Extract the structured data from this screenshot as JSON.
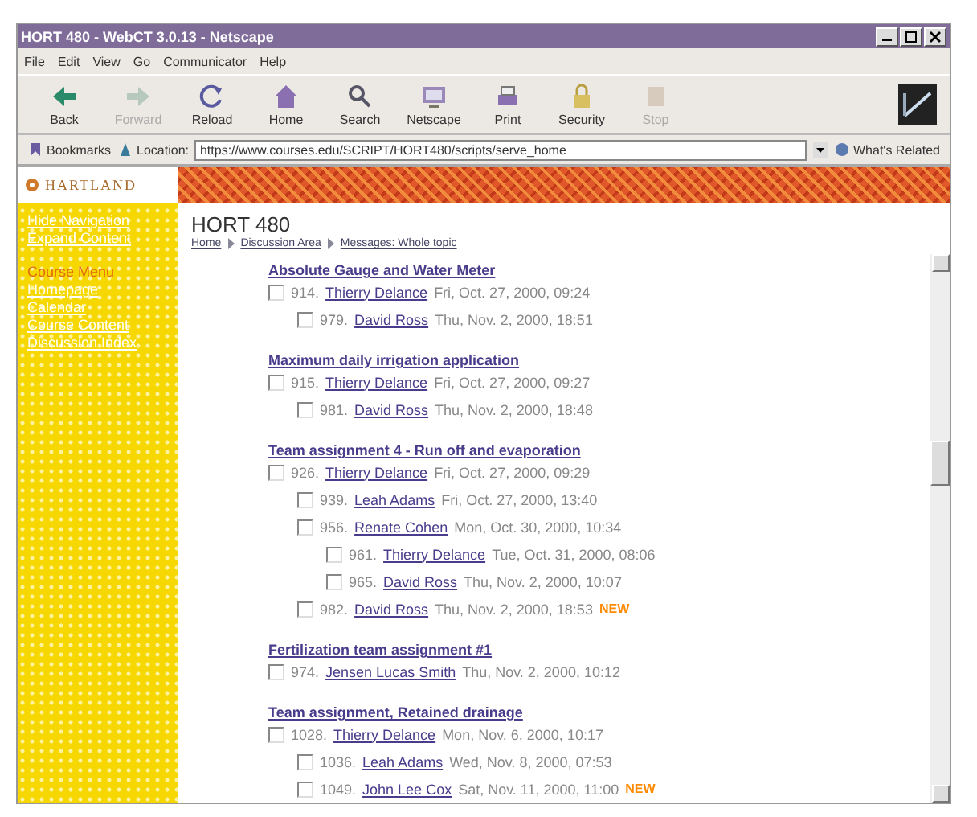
{
  "window": {
    "title": "HORT 480 - WebCT 3.0.13 - Netscape"
  },
  "menu": [
    "File",
    "Edit",
    "View",
    "Go",
    "Communicator",
    "Help"
  ],
  "toolbar": [
    {
      "label": "Back",
      "disabled": false
    },
    {
      "label": "Forward",
      "disabled": true
    },
    {
      "label": "Reload",
      "disabled": false
    },
    {
      "label": "Home",
      "disabled": false
    },
    {
      "label": "Search",
      "disabled": false
    },
    {
      "label": "Netscape",
      "disabled": false
    },
    {
      "label": "Print",
      "disabled": false
    },
    {
      "label": "Security",
      "disabled": false
    },
    {
      "label": "Stop",
      "disabled": true
    }
  ],
  "location_bar": {
    "bookmarks": "Bookmarks",
    "label": "Location:",
    "url": "https://www.courses.edu/SCRIPT/HORT480/scripts/serve_home",
    "related": "What's Related"
  },
  "sidebar": {
    "logo": "HARTLAND",
    "links": [
      "Hide Navigation",
      "Expand Content"
    ],
    "menu_title": "Course Menu",
    "items": [
      "Homepage",
      "Calendar",
      "Course Content",
      "Discussion Index"
    ]
  },
  "page": {
    "title": "HORT 480",
    "breadcrumb": [
      "Home",
      "Discussion Area",
      "Messages: Whole topic"
    ],
    "threads": [
      {
        "topic": "Absolute Gauge and Water Meter",
        "messages": [
          {
            "number": "914.",
            "author": "Thierry Delance",
            "date": "Fri, Oct. 27, 2000, 09:24",
            "checked": false,
            "children": [
              {
                "number": "979.",
                "author": "David Ross",
                "date": "Thu, Nov. 2, 2000, 18:51",
                "checked": false
              }
            ]
          }
        ]
      },
      {
        "topic": "Maximum daily irrigation application",
        "messages": [
          {
            "number": "915.",
            "author": "Thierry Delance",
            "date": "Fri, Oct. 27, 2000, 09:27",
            "checked": false,
            "children": [
              {
                "number": "981.",
                "author": "David Ross",
                "date": "Thu, Nov. 2, 2000, 18:48",
                "checked": false
              }
            ]
          }
        ]
      },
      {
        "topic": "Team assignment 4 - Run off and evaporation",
        "messages": [
          {
            "number": "926.",
            "author": "Thierry Delance",
            "date": "Fri, Oct. 27, 2000, 09:29",
            "checked": false,
            "children": [
              {
                "number": "939.",
                "author": "Leah Adams",
                "date": "Fri, Oct. 27, 2000, 13:40",
                "checked": false
              },
              {
                "number": "956.",
                "author": "Renate Cohen",
                "date": "Mon, Oct. 30, 2000, 10:34",
                "checked": false,
                "children": [
                  {
                    "number": "961.",
                    "author": "Thierry Delance",
                    "date": "Tue, Oct. 31, 2000, 08:06",
                    "checked": false
                  },
                  {
                    "number": "965.",
                    "author": "David Ross",
                    "date": "Thu, Nov. 2, 2000, 10:07",
                    "checked": false
                  }
                ]
              },
              {
                "number": "982.",
                "author": "David Ross",
                "date": "Thu, Nov. 2, 2000, 18:53",
                "checked": false,
                "badge": "NEW"
              }
            ]
          }
        ]
      },
      {
        "topic": "Fertilization team assignment #1",
        "messages": [
          {
            "number": "974.",
            "author": "Jensen Lucas Smith",
            "date": "Thu, Nov. 2, 2000, 10:12",
            "checked": false
          }
        ]
      },
      {
        "topic": "Team assignment, Retained drainage",
        "messages": [
          {
            "number": "1028.",
            "author": "Thierry Delance",
            "date": "Mon, Nov. 6, 2000, 10:17",
            "checked": false,
            "children": [
              {
                "number": "1036.",
                "author": "Leah Adams",
                "date": "Wed, Nov. 8, 2000, 07:53",
                "checked": false
              },
              {
                "number": "1049.",
                "author": "John Lee Cox",
                "date": "Sat, Nov. 11, 2000, 11:00",
                "checked": false,
                "badge": "NEW"
              }
            ]
          }
        ]
      }
    ]
  }
}
